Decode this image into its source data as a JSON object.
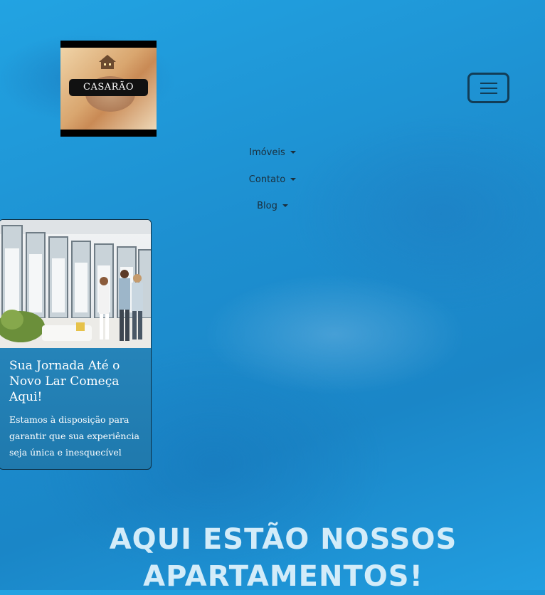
{
  "brand": {
    "logo_text": "CASARÃO"
  },
  "nav": {
    "toggler_icon": "hamburger-icon",
    "items": [
      {
        "label": "Imóveis",
        "icon": "caret-down-icon"
      },
      {
        "label": "Contato",
        "icon": "caret-down-icon"
      },
      {
        "label": "Blog",
        "icon": "caret-down-icon"
      }
    ]
  },
  "card": {
    "title": "Sua Jornada Até o Novo Lar Começa Aqui!",
    "text": "Estamos à disposição para garantir que sua experiência seja única e inesquecível"
  },
  "headline": "AQUI ESTÃO NOSSOS APARTAMENTOS!",
  "colors": {
    "background": "#1d8fd0",
    "nav_text": "#1b2f3d",
    "headline": "#d3ecf9",
    "card_bg": "#2c8fc6",
    "toggler_border": "#123d57"
  }
}
